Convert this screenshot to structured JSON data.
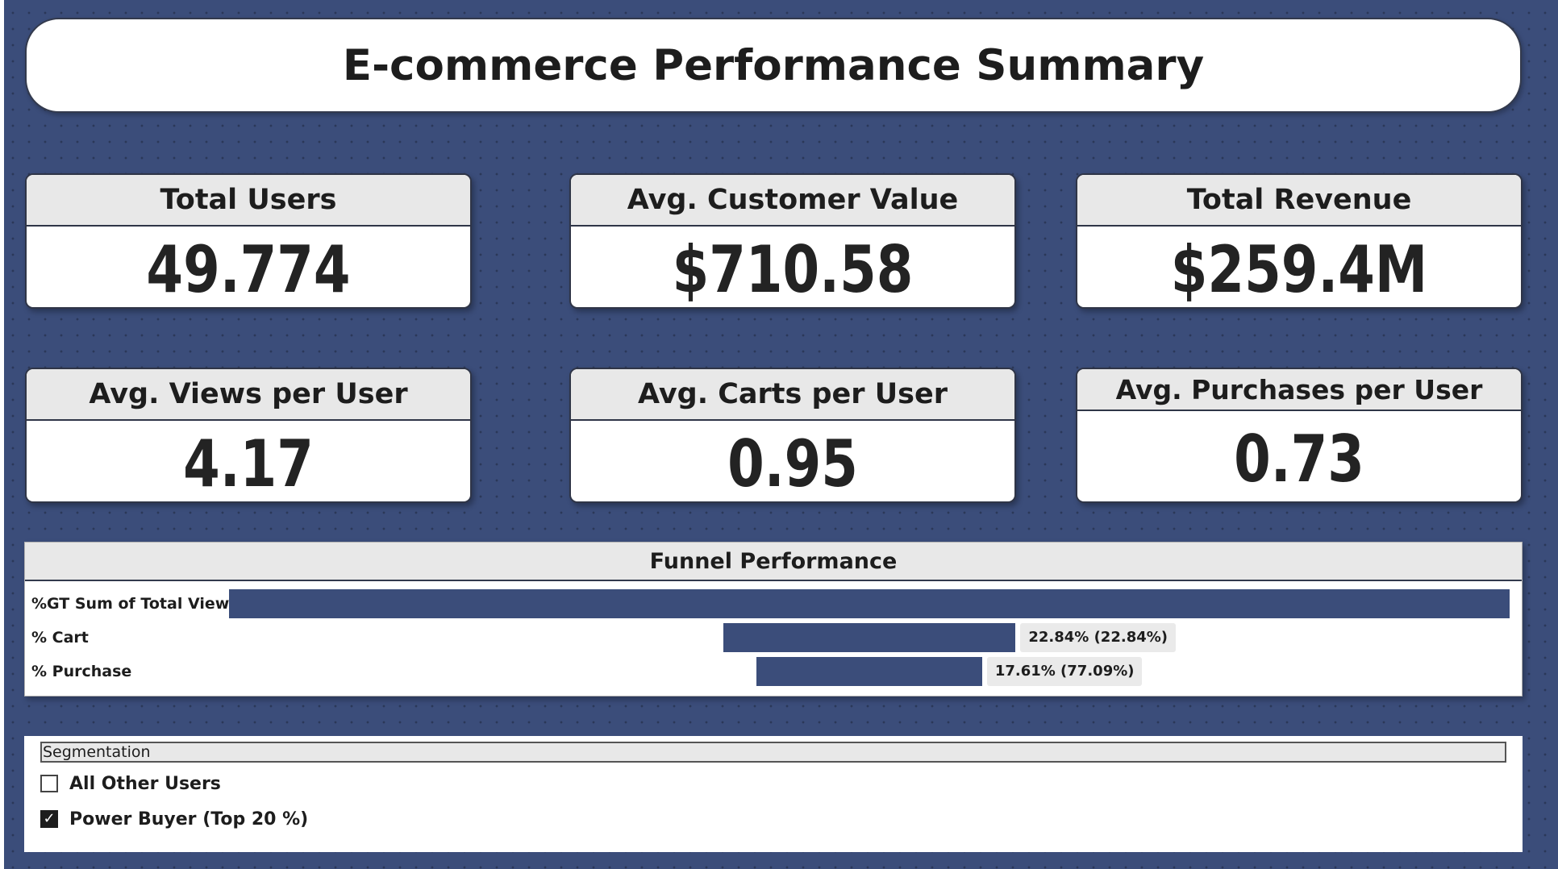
{
  "title": "E-commerce Performance Summary",
  "kpis": [
    {
      "label": "Total Users",
      "value": "49.774"
    },
    {
      "label": "Avg. Customer Value",
      "value": "$710.58"
    },
    {
      "label": "Total Revenue",
      "value": "$259.4M"
    },
    {
      "label": "Avg. Views per User",
      "value": "4.17"
    },
    {
      "label": "Avg. Carts per User",
      "value": "0.95"
    },
    {
      "label": "Avg. Purchases per User",
      "value": "0.73"
    }
  ],
  "funnel": {
    "title": "Funnel Performance",
    "rows": [
      {
        "label": "%GT Sum of Total View",
        "value_pct": 100,
        "data_label": ""
      },
      {
        "label": "% Cart",
        "value_pct": 22.84,
        "data_label": "22.84% (22.84%)"
      },
      {
        "label": "% Purchase",
        "value_pct": 17.61,
        "data_label": "17.61% (77.09%)"
      }
    ]
  },
  "segmentation": {
    "header": "Segmentation",
    "items": [
      {
        "label": "All Other Users",
        "checked": false
      },
      {
        "label": "Power Buyer (Top 20 %)",
        "checked": true
      }
    ]
  },
  "colors": {
    "background": "#3b4d7a",
    "bar": "#3b4d7a",
    "panel_header": "#e8e8e8"
  }
}
